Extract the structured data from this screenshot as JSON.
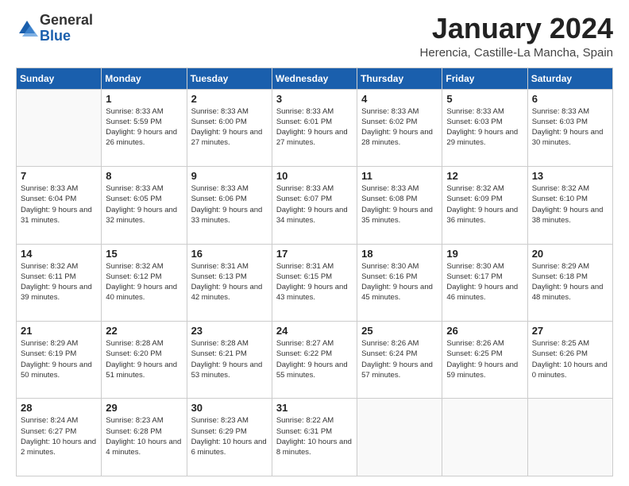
{
  "header": {
    "logo_general": "General",
    "logo_blue": "Blue",
    "title": "January 2024",
    "subtitle": "Herencia, Castille-La Mancha, Spain"
  },
  "days_of_week": [
    "Sunday",
    "Monday",
    "Tuesday",
    "Wednesday",
    "Thursday",
    "Friday",
    "Saturday"
  ],
  "weeks": [
    [
      {
        "day": "",
        "sunrise": "",
        "sunset": "",
        "daylight": ""
      },
      {
        "day": "1",
        "sunrise": "Sunrise: 8:33 AM",
        "sunset": "Sunset: 5:59 PM",
        "daylight": "Daylight: 9 hours and 26 minutes."
      },
      {
        "day": "2",
        "sunrise": "Sunrise: 8:33 AM",
        "sunset": "Sunset: 6:00 PM",
        "daylight": "Daylight: 9 hours and 27 minutes."
      },
      {
        "day": "3",
        "sunrise": "Sunrise: 8:33 AM",
        "sunset": "Sunset: 6:01 PM",
        "daylight": "Daylight: 9 hours and 27 minutes."
      },
      {
        "day": "4",
        "sunrise": "Sunrise: 8:33 AM",
        "sunset": "Sunset: 6:02 PM",
        "daylight": "Daylight: 9 hours and 28 minutes."
      },
      {
        "day": "5",
        "sunrise": "Sunrise: 8:33 AM",
        "sunset": "Sunset: 6:03 PM",
        "daylight": "Daylight: 9 hours and 29 minutes."
      },
      {
        "day": "6",
        "sunrise": "Sunrise: 8:33 AM",
        "sunset": "Sunset: 6:03 PM",
        "daylight": "Daylight: 9 hours and 30 minutes."
      }
    ],
    [
      {
        "day": "7",
        "sunrise": "Sunrise: 8:33 AM",
        "sunset": "Sunset: 6:04 PM",
        "daylight": "Daylight: 9 hours and 31 minutes."
      },
      {
        "day": "8",
        "sunrise": "Sunrise: 8:33 AM",
        "sunset": "Sunset: 6:05 PM",
        "daylight": "Daylight: 9 hours and 32 minutes."
      },
      {
        "day": "9",
        "sunrise": "Sunrise: 8:33 AM",
        "sunset": "Sunset: 6:06 PM",
        "daylight": "Daylight: 9 hours and 33 minutes."
      },
      {
        "day": "10",
        "sunrise": "Sunrise: 8:33 AM",
        "sunset": "Sunset: 6:07 PM",
        "daylight": "Daylight: 9 hours and 34 minutes."
      },
      {
        "day": "11",
        "sunrise": "Sunrise: 8:33 AM",
        "sunset": "Sunset: 6:08 PM",
        "daylight": "Daylight: 9 hours and 35 minutes."
      },
      {
        "day": "12",
        "sunrise": "Sunrise: 8:32 AM",
        "sunset": "Sunset: 6:09 PM",
        "daylight": "Daylight: 9 hours and 36 minutes."
      },
      {
        "day": "13",
        "sunrise": "Sunrise: 8:32 AM",
        "sunset": "Sunset: 6:10 PM",
        "daylight": "Daylight: 9 hours and 38 minutes."
      }
    ],
    [
      {
        "day": "14",
        "sunrise": "Sunrise: 8:32 AM",
        "sunset": "Sunset: 6:11 PM",
        "daylight": "Daylight: 9 hours and 39 minutes."
      },
      {
        "day": "15",
        "sunrise": "Sunrise: 8:32 AM",
        "sunset": "Sunset: 6:12 PM",
        "daylight": "Daylight: 9 hours and 40 minutes."
      },
      {
        "day": "16",
        "sunrise": "Sunrise: 8:31 AM",
        "sunset": "Sunset: 6:13 PM",
        "daylight": "Daylight: 9 hours and 42 minutes."
      },
      {
        "day": "17",
        "sunrise": "Sunrise: 8:31 AM",
        "sunset": "Sunset: 6:15 PM",
        "daylight": "Daylight: 9 hours and 43 minutes."
      },
      {
        "day": "18",
        "sunrise": "Sunrise: 8:30 AM",
        "sunset": "Sunset: 6:16 PM",
        "daylight": "Daylight: 9 hours and 45 minutes."
      },
      {
        "day": "19",
        "sunrise": "Sunrise: 8:30 AM",
        "sunset": "Sunset: 6:17 PM",
        "daylight": "Daylight: 9 hours and 46 minutes."
      },
      {
        "day": "20",
        "sunrise": "Sunrise: 8:29 AM",
        "sunset": "Sunset: 6:18 PM",
        "daylight": "Daylight: 9 hours and 48 minutes."
      }
    ],
    [
      {
        "day": "21",
        "sunrise": "Sunrise: 8:29 AM",
        "sunset": "Sunset: 6:19 PM",
        "daylight": "Daylight: 9 hours and 50 minutes."
      },
      {
        "day": "22",
        "sunrise": "Sunrise: 8:28 AM",
        "sunset": "Sunset: 6:20 PM",
        "daylight": "Daylight: 9 hours and 51 minutes."
      },
      {
        "day": "23",
        "sunrise": "Sunrise: 8:28 AM",
        "sunset": "Sunset: 6:21 PM",
        "daylight": "Daylight: 9 hours and 53 minutes."
      },
      {
        "day": "24",
        "sunrise": "Sunrise: 8:27 AM",
        "sunset": "Sunset: 6:22 PM",
        "daylight": "Daylight: 9 hours and 55 minutes."
      },
      {
        "day": "25",
        "sunrise": "Sunrise: 8:26 AM",
        "sunset": "Sunset: 6:24 PM",
        "daylight": "Daylight: 9 hours and 57 minutes."
      },
      {
        "day": "26",
        "sunrise": "Sunrise: 8:26 AM",
        "sunset": "Sunset: 6:25 PM",
        "daylight": "Daylight: 9 hours and 59 minutes."
      },
      {
        "day": "27",
        "sunrise": "Sunrise: 8:25 AM",
        "sunset": "Sunset: 6:26 PM",
        "daylight": "Daylight: 10 hours and 0 minutes."
      }
    ],
    [
      {
        "day": "28",
        "sunrise": "Sunrise: 8:24 AM",
        "sunset": "Sunset: 6:27 PM",
        "daylight": "Daylight: 10 hours and 2 minutes."
      },
      {
        "day": "29",
        "sunrise": "Sunrise: 8:23 AM",
        "sunset": "Sunset: 6:28 PM",
        "daylight": "Daylight: 10 hours and 4 minutes."
      },
      {
        "day": "30",
        "sunrise": "Sunrise: 8:23 AM",
        "sunset": "Sunset: 6:29 PM",
        "daylight": "Daylight: 10 hours and 6 minutes."
      },
      {
        "day": "31",
        "sunrise": "Sunrise: 8:22 AM",
        "sunset": "Sunset: 6:31 PM",
        "daylight": "Daylight: 10 hours and 8 minutes."
      },
      {
        "day": "",
        "sunrise": "",
        "sunset": "",
        "daylight": ""
      },
      {
        "day": "",
        "sunrise": "",
        "sunset": "",
        "daylight": ""
      },
      {
        "day": "",
        "sunrise": "",
        "sunset": "",
        "daylight": ""
      }
    ]
  ]
}
